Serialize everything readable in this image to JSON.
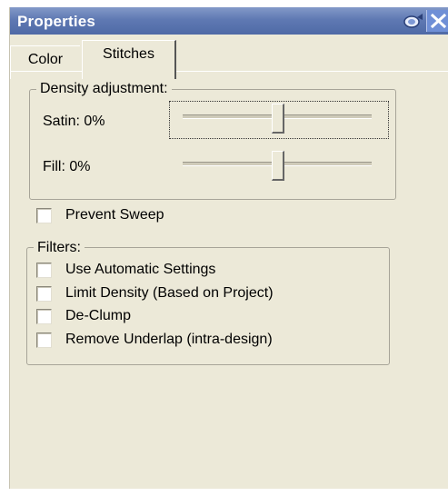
{
  "window": {
    "title": "Properties",
    "pin_icon": "pin-icon",
    "close_icon": "close-icon"
  },
  "tabs": [
    {
      "label": "Color",
      "active": false
    },
    {
      "label": "Stitches",
      "active": true
    }
  ],
  "density": {
    "group_label": "Density adjustment:",
    "satin_label": "Satin: 0%",
    "satin_value_fraction": 0.5,
    "fill_label": "Fill: 0%",
    "fill_value_fraction": 0.5
  },
  "prevent_sweep": {
    "label": "Prevent Sweep",
    "checked": false
  },
  "filters": {
    "group_label": "Filters:",
    "items": [
      {
        "label": "Use Automatic Settings",
        "checked": false
      },
      {
        "label": "Limit Density (Based on Project)",
        "checked": false
      },
      {
        "label": "De-Clump",
        "checked": false
      },
      {
        "label": "Remove Underlap (intra-design)",
        "checked": false
      }
    ]
  },
  "colors": {
    "titlebar": "#5f79b3",
    "panel_bg": "#ece9d8",
    "close_button": "#6f8fd6"
  }
}
